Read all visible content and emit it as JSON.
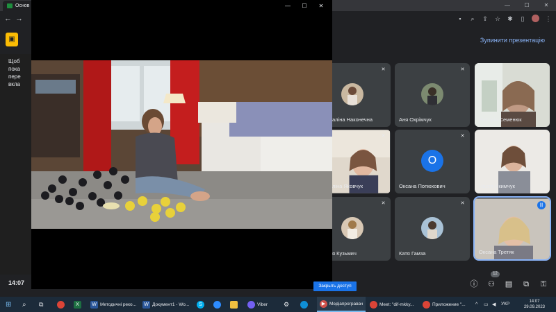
{
  "browser": {
    "tab_title": "Основ",
    "controls": {
      "minimize": "—",
      "maximize": "☐",
      "close": "✕"
    }
  },
  "meet": {
    "stop_presentation": "Зупинити презентацію",
    "side_text": [
      "Щоб",
      "пока",
      "пере",
      "вкла"
    ],
    "time": "14:07",
    "people_badge": "12",
    "share_button": "Закрыть доступ"
  },
  "player": {
    "controls": {
      "minimize": "—",
      "maximize": "☐",
      "close": "✕"
    }
  },
  "participants": [
    {
      "name": "аліна Наконечна",
      "kind": "avatar"
    },
    {
      "name": "Аня Охрімчук",
      "kind": "avatar"
    },
    {
      "name": "Вікторія Семенюк",
      "kind": "camera"
    },
    {
      "name": "ліна Яковчук",
      "kind": "camera"
    },
    {
      "name": "Оксана Попюхович",
      "kind": "letter",
      "letter": "О"
    },
    {
      "name": "Настя Якимчук",
      "kind": "camera"
    },
    {
      "name": "я Кузьмич",
      "kind": "avatar"
    },
    {
      "name": "Катя Гамза",
      "kind": "avatar"
    },
    {
      "name": "Оксана Третяк",
      "kind": "camera",
      "speaking": true
    }
  ],
  "taskbar": {
    "items": [
      {
        "label": "Методичні реко..."
      },
      {
        "label": "Документ1 - Wo..."
      },
      {
        "label": "Viber"
      },
      {
        "label": "Медіапрогравач"
      },
      {
        "label": "Meet: \"dif-mkky..."
      },
      {
        "label": "Приложение \"..."
      }
    ],
    "language": "УКР",
    "time": "14:07",
    "date": "29.09.2023"
  },
  "colors": {
    "accent": "#8ab4f8",
    "meet_bg": "#202124",
    "tile_bg": "#3c4043",
    "taskbar_bg": "#1c2b3a"
  }
}
